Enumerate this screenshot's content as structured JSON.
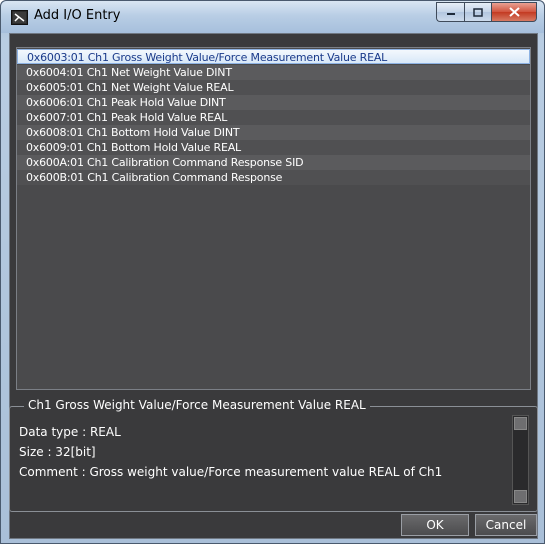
{
  "window": {
    "title": "Add I/O Entry"
  },
  "entries": [
    "0x6003:01 Ch1 Gross Weight Value/Force Measurement Value REAL",
    "0x6004:01 Ch1 Net Weight Value DINT",
    "0x6005:01 Ch1 Net Weight Value REAL",
    "0x6006:01 Ch1 Peak Hold Value DINT",
    "0x6007:01 Ch1 Peak Hold Value REAL",
    "0x6008:01 Ch1 Bottom Hold Value DINT",
    "0x6009:01 Ch1 Bottom Hold Value REAL",
    "0x600A:01 Ch1 Calibration Command Response SID",
    "0x600B:01 Ch1 Calibration Command Response"
  ],
  "selected_index": 0,
  "details": {
    "title": "Ch1 Gross Weight Value/Force Measurement Value REAL",
    "data_type": "Data type : REAL",
    "size": "Size : 32[bit]",
    "comment": "Comment : Gross weight value/Force measurement value REAL of Ch1"
  },
  "buttons": {
    "ok": "OK",
    "cancel": "Cancel"
  },
  "colors": {
    "background": "#3a3a3c",
    "selected_row": "#d8e8f8",
    "selected_text": "#1a3a8a"
  }
}
